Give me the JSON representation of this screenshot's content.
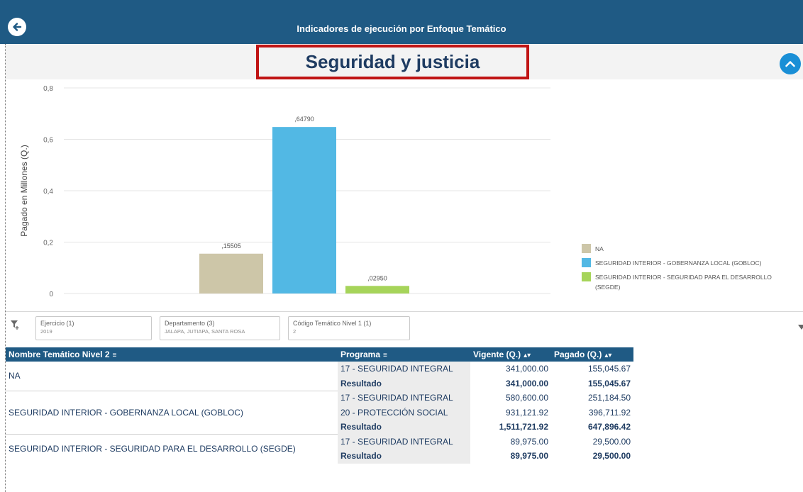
{
  "header": {
    "title": "Indicadores de ejecución por Enfoque Temático",
    "back_icon": "arrow-left-circle-icon"
  },
  "page_title": "Seguridad y justicia",
  "collapse_icon": "chevron-up-circle-icon",
  "chart_data": {
    "type": "bar",
    "ylabel": "Pagado en Millones (Q.)",
    "xlabel": "",
    "ylim": [
      0,
      0.8
    ],
    "y_ticks": [
      "0",
      "0,2",
      "0,4",
      "0,6",
      "0,8"
    ],
    "y_tick_values": [
      0,
      0.2,
      0.4,
      0.6,
      0.8
    ],
    "grid": true,
    "legend_position": "right",
    "series": [
      {
        "name": "NA",
        "value": 0.15505,
        "label": ",15505",
        "color": "#cdc6a8"
      },
      {
        "name": "SEGURIDAD INTERIOR - GOBERNANZA LOCAL (GOBLOC)",
        "value": 0.6479,
        "label": ",64790",
        "color": "#52b8e4"
      },
      {
        "name": "SEGURIDAD INTERIOR - SEGURIDAD PARA EL DESARROLLO (SEGDE)",
        "value": 0.0295,
        "label": ",02950",
        "color": "#a6d45a"
      }
    ]
  },
  "legend": {
    "items": [
      {
        "label": "NA",
        "color": "#cdc6a8"
      },
      {
        "label": "SEGURIDAD INTERIOR - GOBERNANZA LOCAL (GOBLOC)",
        "color": "#52b8e4"
      },
      {
        "label": "SEGURIDAD INTERIOR - SEGURIDAD PARA EL DESARROLLO (SEGDE)",
        "color": "#a6d45a"
      }
    ]
  },
  "filters": {
    "icon": "filter-add-icon",
    "chips": [
      {
        "title": "Ejercicio (1)",
        "value": "2019"
      },
      {
        "title": "Departamento (3)",
        "value": "JALAPA, JUTIAPA, SANTA ROSA"
      },
      {
        "title": "Código Temático Nivel 1 (1)",
        "value": "2"
      }
    ]
  },
  "table": {
    "headers": {
      "tema": "Nombre Temático Nivel 2",
      "programa": "Programa",
      "vigente": "Vigente (Q.)",
      "pagado": "Pagado (Q.)"
    },
    "groups": [
      {
        "name": "NA",
        "rows": [
          {
            "programa": "17 - SEGURIDAD INTEGRAL",
            "vigente": "341,000.00",
            "pagado": "155,045.67"
          }
        ],
        "result": {
          "label": "Resultado",
          "vigente": "341,000.00",
          "pagado": "155,045.67"
        }
      },
      {
        "name": "SEGURIDAD INTERIOR - GOBERNANZA LOCAL (GOBLOC)",
        "rows": [
          {
            "programa": "17 - SEGURIDAD INTEGRAL",
            "vigente": "580,600.00",
            "pagado": "251,184.50"
          },
          {
            "programa": "20 - PROTECCIÓN SOCIAL",
            "vigente": "931,121.92",
            "pagado": "396,711.92"
          }
        ],
        "result": {
          "label": "Resultado",
          "vigente": "1,511,721.92",
          "pagado": "647,896.42"
        }
      },
      {
        "name": "SEGURIDAD INTERIOR - SEGURIDAD PARA EL DESARROLLO (SEGDE)",
        "rows": [
          {
            "programa": "17 - SEGURIDAD INTEGRAL",
            "vigente": "89,975.00",
            "pagado": "29,500.00"
          }
        ],
        "result": {
          "label": "Resultado",
          "vigente": "89,975.00",
          "pagado": "29,500.00"
        }
      }
    ]
  }
}
